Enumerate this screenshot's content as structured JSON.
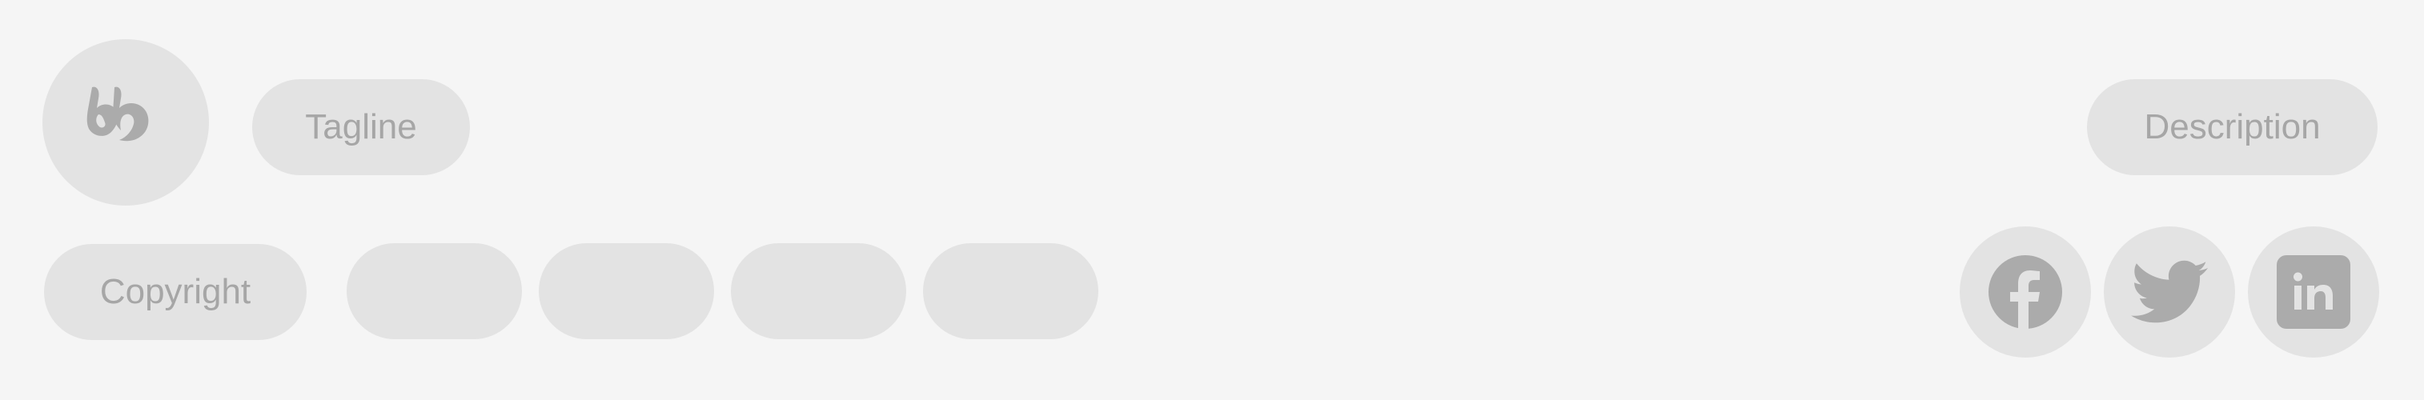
{
  "header": {
    "logo": {
      "icon": "brand-logo-icon"
    },
    "tagline": "Tagline",
    "description": "Description"
  },
  "footer": {
    "copyright": "Copyright",
    "links": [
      "",
      "",
      "",
      ""
    ],
    "social": [
      {
        "name": "facebook",
        "icon": "facebook-icon"
      },
      {
        "name": "twitter",
        "icon": "twitter-icon"
      },
      {
        "name": "linkedin",
        "icon": "linkedin-icon"
      }
    ]
  },
  "colors": {
    "background": "#f5f5f5",
    "placeholder_fill": "#e3e3e3",
    "placeholder_text": "#a6a6a6"
  }
}
